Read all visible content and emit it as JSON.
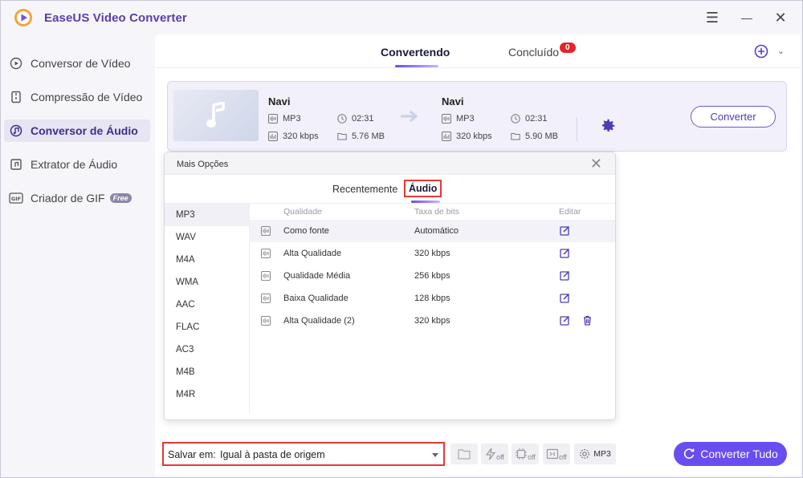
{
  "app": {
    "title": "EaseUS Video Converter"
  },
  "window_controls": {
    "menu": "☰",
    "minimize": "—",
    "close": "✕"
  },
  "sidebar": {
    "items": [
      {
        "label": "Conversor de Vídeo",
        "icon": "video-convert-icon"
      },
      {
        "label": "Compressão de Vídeo",
        "icon": "compress-icon"
      },
      {
        "label": "Conversor de Áudio",
        "icon": "audio-convert-icon",
        "active": true
      },
      {
        "label": "Extrator de Áudio",
        "icon": "audio-extract-icon"
      },
      {
        "label": "Criador de GIF",
        "icon": "gif-icon",
        "badge": "Free"
      }
    ]
  },
  "tabs": {
    "converting": "Convertendo",
    "done": "Concluído",
    "done_count": "0"
  },
  "file": {
    "source": {
      "name": "Navi",
      "format": "MP3",
      "duration": "02:31",
      "bitrate": "320 kbps",
      "size": "5.76 MB"
    },
    "target": {
      "name": "Navi",
      "format": "MP3",
      "duration": "02:31",
      "bitrate": "320 kbps",
      "size": "5.90 MB"
    },
    "convert_label": "Converter"
  },
  "options": {
    "title": "Mais Opções",
    "tabs": {
      "recent": "Recentemente",
      "audio": "Áudio"
    },
    "formats": [
      "MP3",
      "WAV",
      "M4A",
      "WMA",
      "AAC",
      "FLAC",
      "AC3",
      "M4B",
      "M4R"
    ],
    "columns": {
      "quality": "Qualidade",
      "bitrate": "Taxa de bits",
      "edit": "Editar"
    },
    "rows": [
      {
        "quality": "Como fonte",
        "bitrate": "Automático"
      },
      {
        "quality": "Alta Qualidade",
        "bitrate": "320 kbps"
      },
      {
        "quality": "Qualidade Média",
        "bitrate": "256 kbps"
      },
      {
        "quality": "Baixa Qualidade",
        "bitrate": "128 kbps"
      },
      {
        "quality": "Alta Qualidade (2)",
        "bitrate": "320 kbps"
      }
    ]
  },
  "bottom": {
    "save_label": "Salvar em:",
    "save_value": "Igual à pasta de origem",
    "off_label": "off",
    "format_label": "MP3",
    "convert_all": "Converter Tudo"
  },
  "colors": {
    "accent": "#6a4df0",
    "highlight": "#e53935",
    "badge": "#e4232a"
  }
}
